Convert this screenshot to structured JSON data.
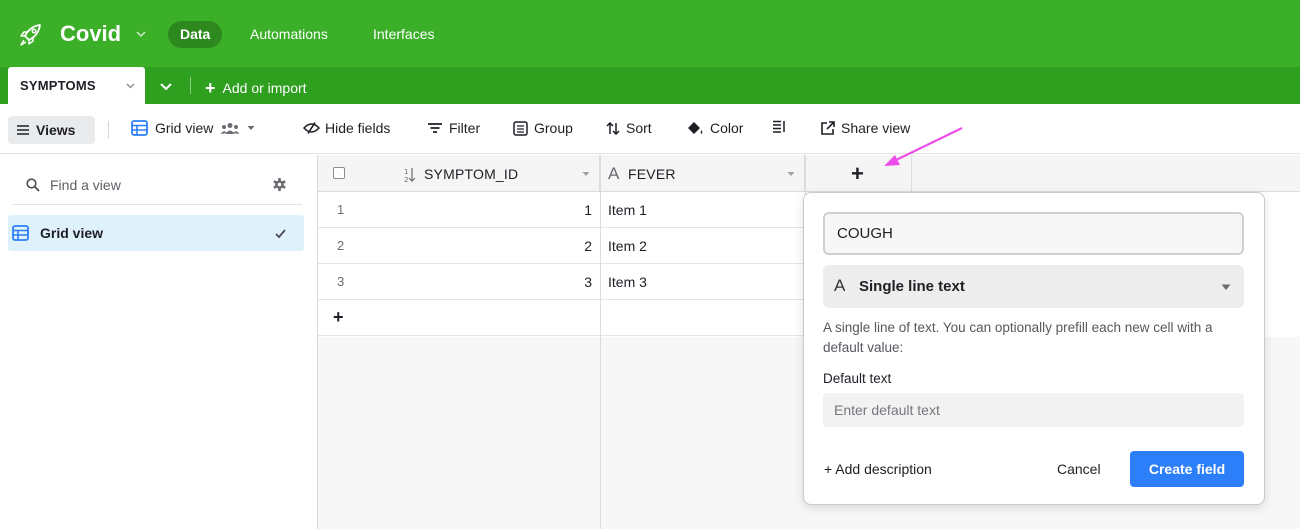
{
  "topbar": {
    "base_name": "Covid",
    "nav": [
      {
        "label": "Data",
        "active": true
      },
      {
        "label": "Automations",
        "active": false
      },
      {
        "label": "Interfaces",
        "active": false
      }
    ]
  },
  "tabs": {
    "active_table": "SYMPTOMS",
    "add_import": "Add or import"
  },
  "toolbar": {
    "views": "Views",
    "grid_view": "Grid view",
    "hide_fields": "Hide fields",
    "filter": "Filter",
    "group": "Group",
    "sort": "Sort",
    "color": "Color",
    "share_view": "Share view"
  },
  "sidebar": {
    "find_placeholder": "Find a view",
    "views": [
      {
        "label": "Grid view",
        "selected": true
      }
    ]
  },
  "grid": {
    "columns": [
      {
        "name": "SYMPTOM_ID",
        "type": "autonumber-icon"
      },
      {
        "name": "FEVER",
        "type": "text-icon"
      }
    ],
    "add_column": "+",
    "add_row": "+",
    "rows": [
      {
        "num": "1",
        "id": "1",
        "fever": "Item 1"
      },
      {
        "num": "2",
        "id": "2",
        "fever": "Item 2"
      },
      {
        "num": "3",
        "id": "3",
        "fever": "Item 3"
      }
    ]
  },
  "popup": {
    "field_name": "COUGH",
    "field_type": "Single line text",
    "field_type_icon": "A",
    "description": "A single line of text. You can optionally prefill each new cell with a default value:",
    "default_label": "Default text",
    "default_placeholder": "Enter default text",
    "add_description": "+ Add description",
    "cancel": "Cancel",
    "create": "Create field"
  },
  "colors": {
    "topbar": "#3aaf27",
    "tabbar": "#2e9f1f",
    "primary_button": "#2d7ff9",
    "arrow": "#ee4ee8",
    "selected_view": "#dff1fb"
  }
}
